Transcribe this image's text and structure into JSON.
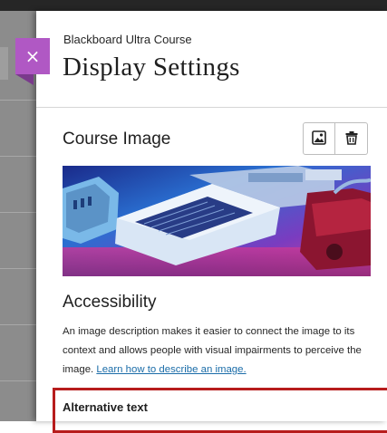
{
  "header": {
    "kicker": "Blackboard Ultra Course",
    "title": "Display Settings",
    "close_label": "×"
  },
  "course_image": {
    "heading": "Course Image",
    "change_icon": "image-edit-icon",
    "delete_icon": "trash-icon"
  },
  "accessibility": {
    "heading": "Accessibility",
    "description": "An image description makes it easier to connect the image to its context and allows people with visual impairments to perceive the image.",
    "link_text": "Learn how to describe an image.",
    "alt_text_label": "Alternative text"
  },
  "colors": {
    "close_button": "#b058c4",
    "highlight_border": "#b71c1c",
    "link": "#1a6ca8"
  }
}
